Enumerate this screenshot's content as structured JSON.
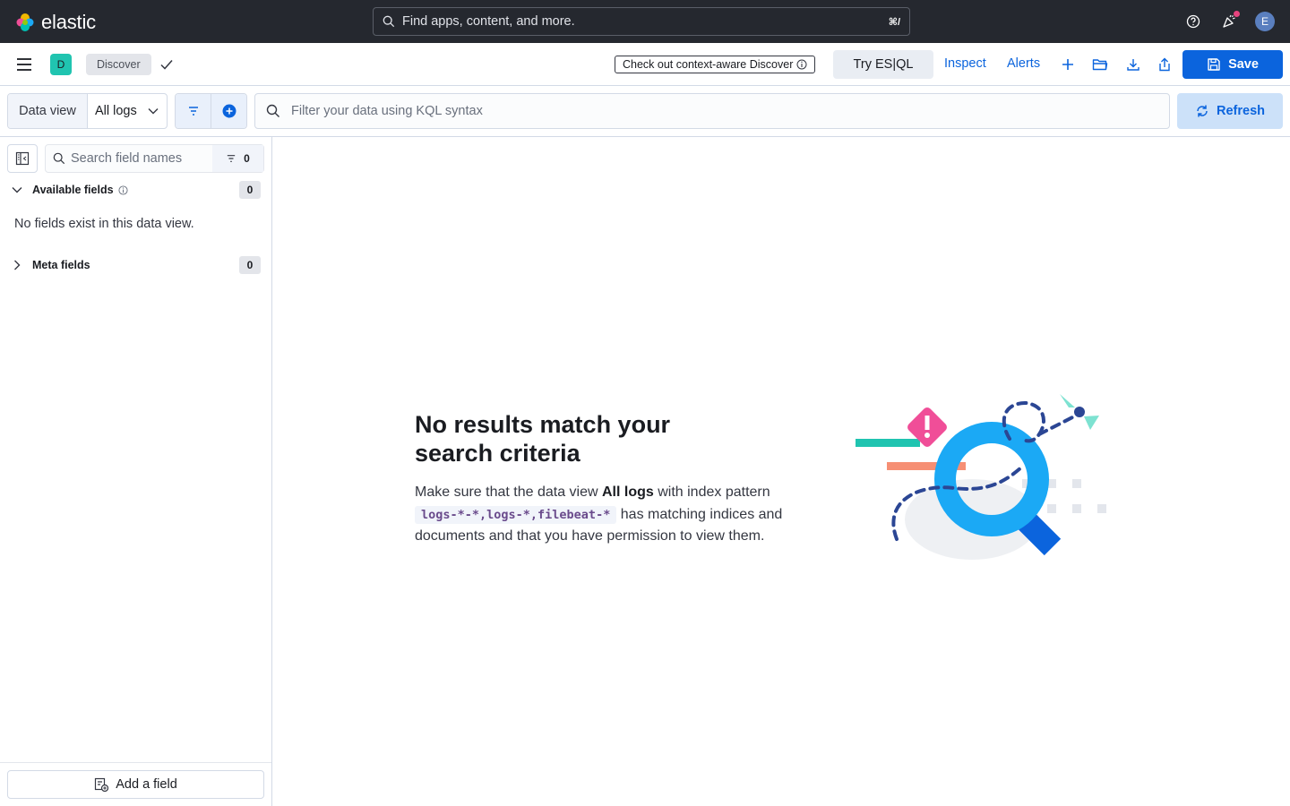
{
  "topbar": {
    "logo_text": "elastic",
    "search_placeholder": "Find apps, content, and more.",
    "search_shortcut": "⌘/",
    "avatar_initial": "E"
  },
  "appbar": {
    "space_initial": "D",
    "breadcrumb": "Discover",
    "context_aware_label": "Check out context-aware Discover",
    "esql_label": "Try ES|QL",
    "inspect_label": "Inspect",
    "alerts_label": "Alerts",
    "save_label": "Save"
  },
  "querybar": {
    "data_view_label": "Data view",
    "data_view_value": "All logs",
    "kql_placeholder": "Filter your data using KQL syntax",
    "refresh_label": "Refresh"
  },
  "sidebar": {
    "search_placeholder": "Search field names",
    "filter_count": "0",
    "available_fields": {
      "label": "Available fields",
      "count": "0"
    },
    "empty_message": "No fields exist in this data view.",
    "meta_fields": {
      "label": "Meta fields",
      "count": "0"
    },
    "add_field_label": "Add a field"
  },
  "main": {
    "title": "No results match your search criteria",
    "body_prefix": "Make sure that the data view ",
    "data_view_name": "All logs",
    "body_mid": " with index pattern ",
    "index_pattern": "logs-*-*,logs-*,filebeat-*",
    "body_suffix": " has matching indices and documents and that you have permission to view them."
  },
  "colors": {
    "header_bg": "#25282f",
    "primary": "#0b64dd",
    "space_badge": "#20c4b0",
    "refresh_bg": "#cce1f9"
  }
}
